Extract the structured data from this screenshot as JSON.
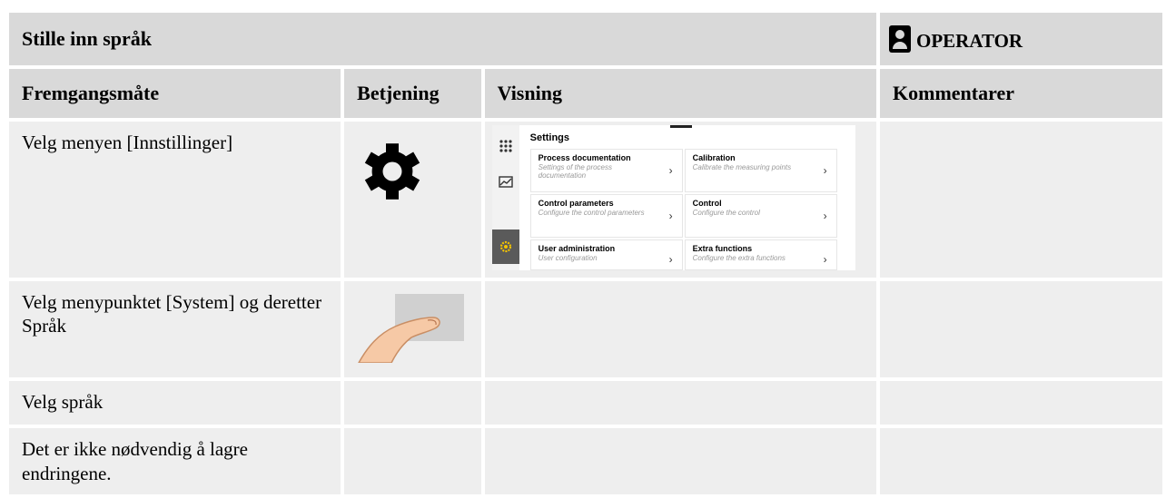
{
  "header": {
    "title": "Stille inn språk",
    "role": "OPERATOR"
  },
  "columns": [
    "Fremgangsmåte",
    "Betjening",
    "Visning",
    "Kommentarer"
  ],
  "rows": [
    {
      "step": "Velg menyen [Innstillinger]",
      "control_icon": "gear-icon"
    },
    {
      "step": "Velg menypunktet [System] og deretter Språk",
      "control_icon": "touch-finger-icon"
    },
    {
      "step": "Velg språk"
    },
    {
      "step": "Det er ikke nødvendig å lagre endringene."
    }
  ],
  "settings_screenshot": {
    "title": "Settings",
    "cards": [
      {
        "title": "Process documentation",
        "subtitle": "Settings of the process documentation"
      },
      {
        "title": "Calibration",
        "subtitle": "Calibrate the measuring points"
      },
      {
        "title": "Control parameters",
        "subtitle": "Configure the control parameters"
      },
      {
        "title": "Control",
        "subtitle": "Configure the control"
      },
      {
        "title": "User administration",
        "subtitle": "User configuration"
      },
      {
        "title": "Extra functions",
        "subtitle": "Configure the extra functions"
      }
    ],
    "chevron": "›"
  }
}
